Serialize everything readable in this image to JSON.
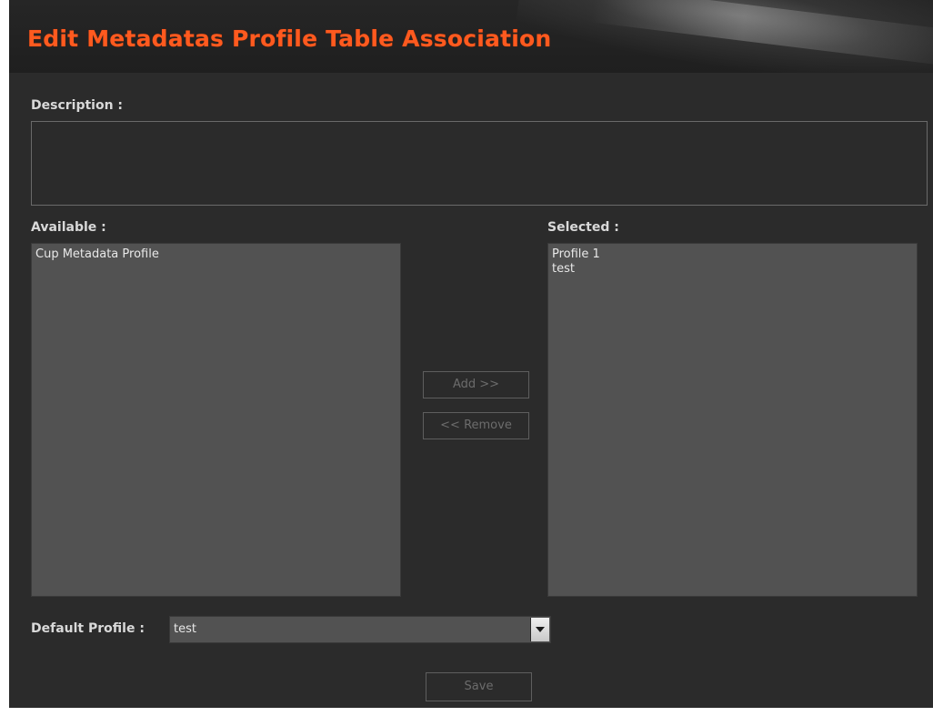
{
  "header": {
    "title": "Edit Metadatas Profile Table Association"
  },
  "form": {
    "description_label": "Description :",
    "description_value": "",
    "available_label": "Available :",
    "selected_label": "Selected :",
    "default_profile_label": "Default Profile :"
  },
  "available": {
    "items": [
      {
        "label": "Cup Metadata Profile"
      }
    ]
  },
  "selected": {
    "items": [
      {
        "label": "Profile 1"
      },
      {
        "label": "test"
      }
    ]
  },
  "buttons": {
    "add": "Add >>",
    "remove": "<< Remove",
    "save": "Save"
  },
  "default_profile": {
    "value": "test"
  },
  "colors": {
    "title": "#ff5a1f",
    "background": "#2b2b2b",
    "list_background": "#525252"
  },
  "icons": {
    "dropdown": "chevron-down-icon"
  }
}
